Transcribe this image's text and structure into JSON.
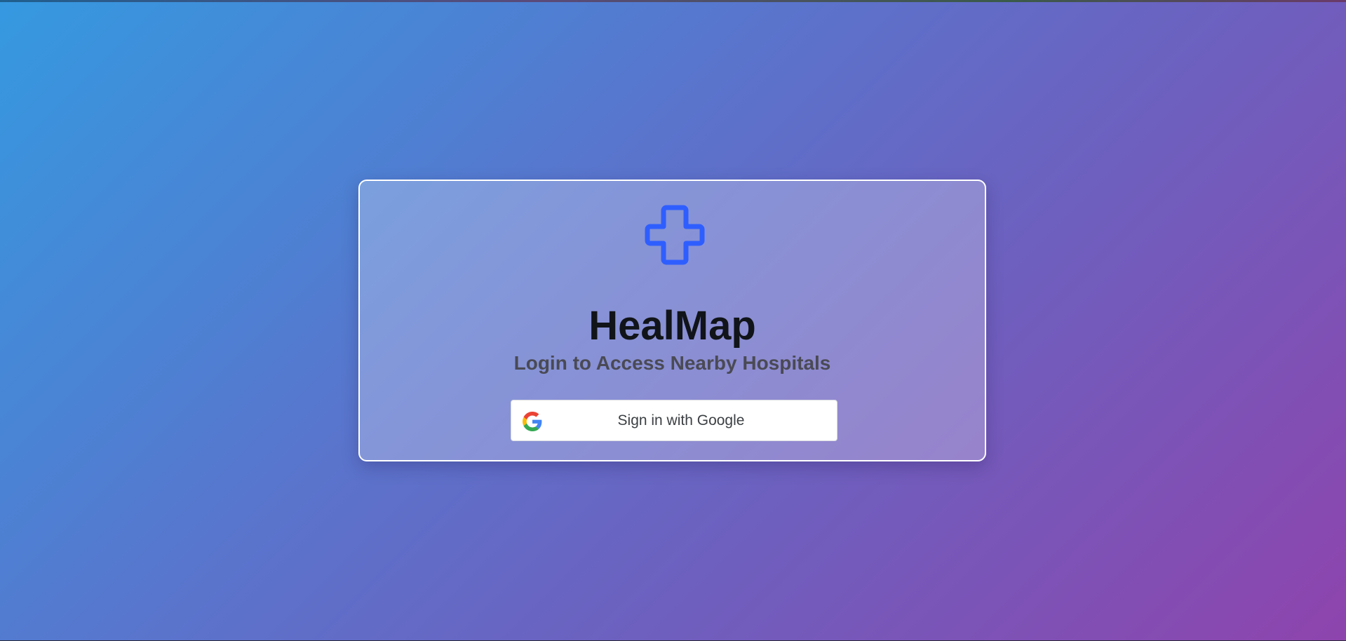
{
  "app": {
    "title": "HealMap",
    "subtitle": "Login to Access Nearby Hospitals",
    "logo_icon": "medical-cross-icon",
    "accent_color": "#2f5eff"
  },
  "login": {
    "google_button_label": "Sign in with Google",
    "google_icon": "google-g-icon"
  },
  "colors": {
    "background_gradient_start": "#3599e0",
    "background_gradient_end": "#8e44ad",
    "card_border": "#ffffff",
    "title_color": "#111419",
    "subtitle_color": "#4a4a55"
  }
}
